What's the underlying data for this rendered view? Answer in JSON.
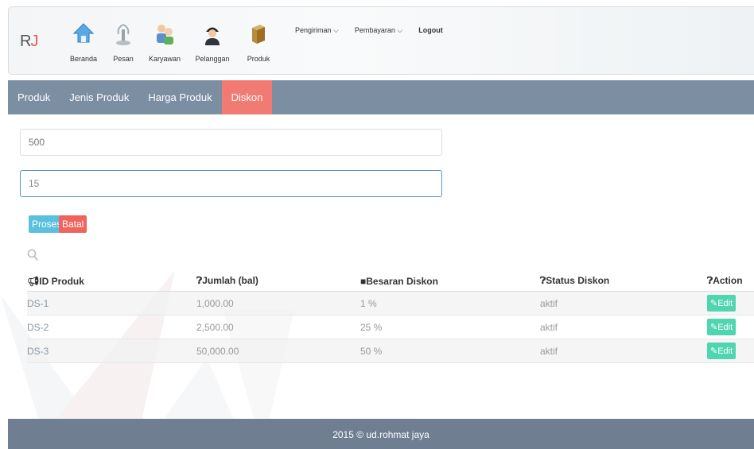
{
  "brand": {
    "letter": "R",
    "accent_letter": "J"
  },
  "nav": {
    "items": [
      {
        "label": "Beranda",
        "icon": "home-icon"
      },
      {
        "label": "Pesan",
        "icon": "fountain-icon"
      },
      {
        "label": "Karyawan",
        "icon": "employees-icon"
      },
      {
        "label": "Pelanggan",
        "icon": "customer-icon"
      },
      {
        "label": "Produk",
        "icon": "product-box-icon"
      }
    ],
    "menus": [
      {
        "label": "Pengiriman ⌵"
      },
      {
        "label": "Pembayaran ⌵"
      }
    ],
    "logout": "Logout"
  },
  "tabs": [
    {
      "label": "Produk"
    },
    {
      "label": "Jenis Produk"
    },
    {
      "label": "Harga Produk"
    },
    {
      "label": "Diskon",
      "active": true
    }
  ],
  "form": {
    "jumlah_placeholder": "500",
    "diskon_value": "15",
    "proses_label": "Proses",
    "batal_label": "Batal"
  },
  "table": {
    "headers": [
      "⚠ID Produk",
      "⓿Jumlah (bal)",
      "■Besaran Diskon",
      "⓿Status Diskon",
      "⓿Action"
    ],
    "header_icons": [
      "megaphone-icon",
      "question-circle-icon",
      "bookmark-icon",
      "question-circle-icon",
      "question-circle-icon"
    ],
    "header_texts": [
      "ID Produk",
      "Jumlah (bal)",
      "Besaran Diskon",
      "Status Diskon",
      "Action"
    ],
    "rows": [
      {
        "id": "DS-1",
        "jumlah": "1,000.00",
        "besaran": "1 %",
        "status": "aktif",
        "action": "Edit"
      },
      {
        "id": "DS-2",
        "jumlah": "2,500.00",
        "besaran": "25 %",
        "status": "aktif",
        "action": "Edit"
      },
      {
        "id": "DS-3",
        "jumlah": "50,000.00",
        "besaran": "50 %",
        "status": "aktif",
        "action": "Edit"
      }
    ]
  },
  "footer": {
    "text": "2015 © ud.rohmat jaya"
  },
  "colors": {
    "tabbar": "#7c8ea1",
    "active_tab": "#f17a72",
    "proses": "#5bc0de",
    "batal": "#f0645d",
    "edit": "#4fd6b0",
    "footer": "#6f7e90"
  }
}
